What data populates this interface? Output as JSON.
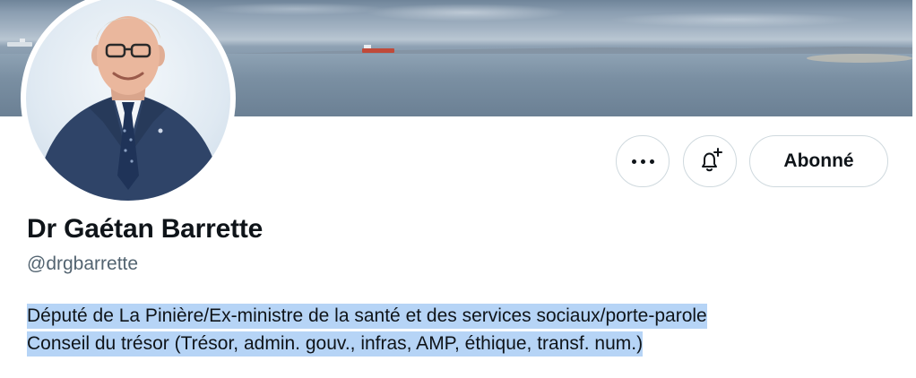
{
  "profile": {
    "display_name": "Dr Gaétan Barrette",
    "handle": "@drgbarrette",
    "bio_line_1": "Député de La Pinière/Ex-ministre de la santé et des services sociaux/porte-parole",
    "bio_line_2": "Conseil du trésor (Trésor, admin. gouv., infras, AMP, éthique, transf. num.)",
    "bio_selected": true
  },
  "actions": {
    "more_icon": "more-horizontal-icon",
    "notify_icon": "bell-plus-icon",
    "follow_label": "Abonné"
  },
  "colors": {
    "text_primary": "#0f1419",
    "text_secondary": "#536471",
    "button_border": "#cfd9de",
    "selection": "#b6d4f6"
  }
}
